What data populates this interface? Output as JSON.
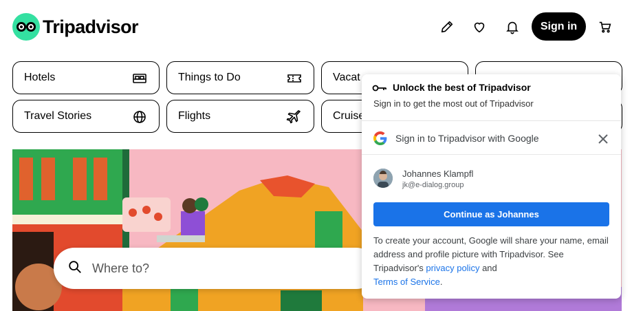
{
  "header": {
    "brand": "Tripadvisor",
    "signin_label": "Sign in",
    "icons": [
      "pencil-icon",
      "heart-icon",
      "bell-icon",
      "cart-icon"
    ]
  },
  "categories": [
    {
      "label": "Hotels",
      "icon": "bed-icon"
    },
    {
      "label": "Things to Do",
      "icon": "ticket-icon"
    },
    {
      "label": "Vacat",
      "icon": "house-icon"
    },
    {
      "label": "",
      "icon": "fork-knife-icon"
    },
    {
      "label": "Travel Stories",
      "icon": "globe-icon"
    },
    {
      "label": "Flights",
      "icon": "plane-icon"
    },
    {
      "label": "Cruise",
      "icon": "ship-icon"
    }
  ],
  "search": {
    "placeholder": "Where to?"
  },
  "popup": {
    "title": "Unlock the best of Tripadvisor",
    "subtitle": "Sign in to get the most out of Tripadvisor",
    "google_title": "Sign in to Tripadvisor with Google",
    "account_name": "Johannes Klampfl",
    "account_email": "jk@e-dialog.group",
    "continue_label": "Continue as Johannes",
    "disclaimer_1": "To create your account, Google will share your name, email address and profile picture with Tripadvisor. See Tripadvisor's ",
    "privacy_link": "privacy policy",
    "disclaimer_2": " and",
    "terms_link": "Terms of Service",
    "disclaimer_3": "."
  },
  "colors": {
    "brand_green": "#34e0a1",
    "google_blue": "#1a73e8"
  }
}
